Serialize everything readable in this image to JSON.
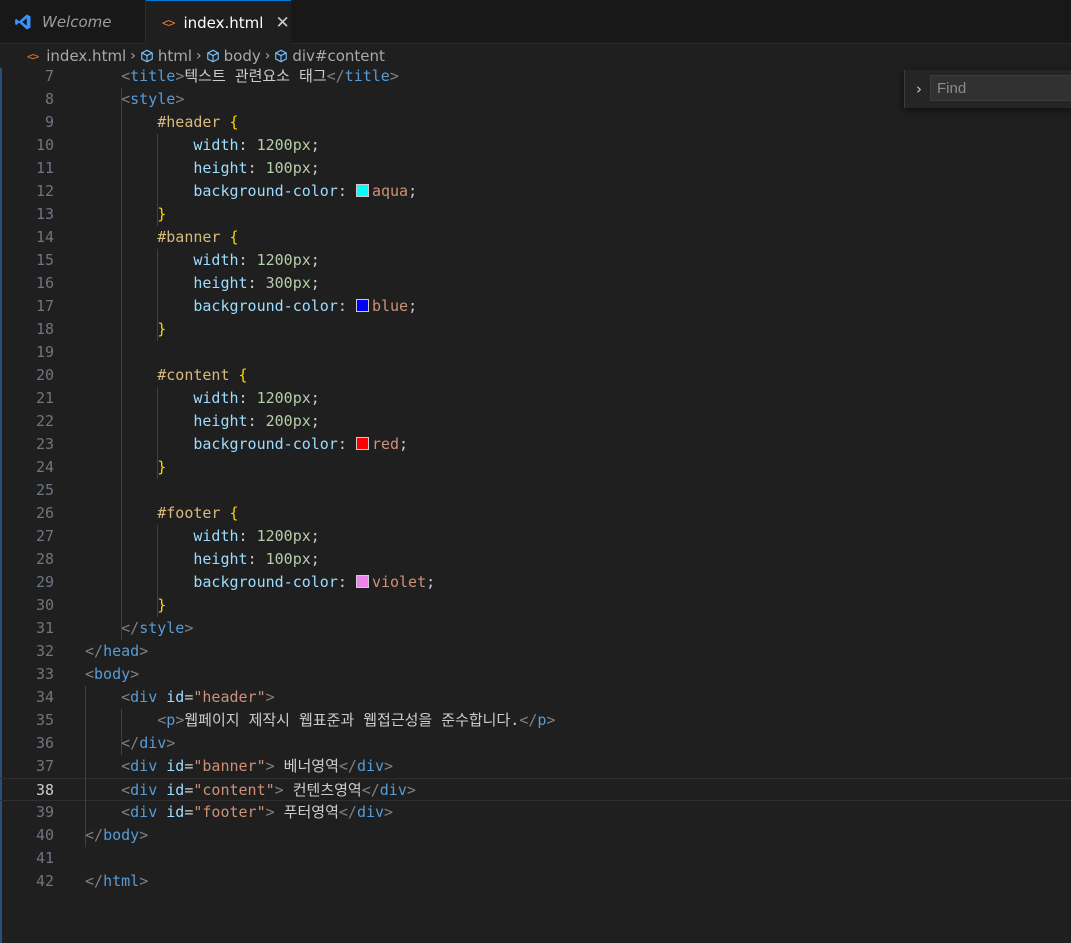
{
  "tabs": [
    {
      "label": "Welcome",
      "icon": "vscode-icon"
    },
    {
      "label": "index.html",
      "icon": "html-file-icon",
      "close_glyph": "✕"
    }
  ],
  "breadcrumb": [
    "index.html",
    "html",
    "body",
    "div#content"
  ],
  "find": {
    "placeholder": "Find",
    "toggle_glyph": "›"
  },
  "colors": {
    "aqua": "#00ffff",
    "blue": "#0000ff",
    "red": "#ff0000",
    "violet": "#ee82ee"
  },
  "current_line": 38,
  "lines": [
    {
      "n": "7",
      "t": "    <title>텍스트 관련요소 태그</title>"
    },
    {
      "n": "8",
      "t": "    <style>"
    },
    {
      "n": "9",
      "t": "        #header {"
    },
    {
      "n": "10",
      "t": "            width: 1200px;"
    },
    {
      "n": "11",
      "t": "            height: 100px;"
    },
    {
      "n": "12",
      "t": "            background-color: aqua;"
    },
    {
      "n": "13",
      "t": "        }"
    },
    {
      "n": "14",
      "t": "        #banner {"
    },
    {
      "n": "15",
      "t": "            width: 1200px;"
    },
    {
      "n": "16",
      "t": "            height: 300px;"
    },
    {
      "n": "17",
      "t": "            background-color: blue;"
    },
    {
      "n": "18",
      "t": "        }"
    },
    {
      "n": "19",
      "t": ""
    },
    {
      "n": "20",
      "t": "        #content {"
    },
    {
      "n": "21",
      "t": "            width: 1200px;"
    },
    {
      "n": "22",
      "t": "            height: 200px;"
    },
    {
      "n": "23",
      "t": "            background-color: red;"
    },
    {
      "n": "24",
      "t": "        }"
    },
    {
      "n": "25",
      "t": ""
    },
    {
      "n": "26",
      "t": "        #footer {"
    },
    {
      "n": "27",
      "t": "            width: 1200px;"
    },
    {
      "n": "28",
      "t": "            height: 100px;"
    },
    {
      "n": "29",
      "t": "            background-color: violet;"
    },
    {
      "n": "30",
      "t": "        }"
    },
    {
      "n": "31",
      "t": "    </style>"
    },
    {
      "n": "32",
      "t": "</head>"
    },
    {
      "n": "33",
      "t": "<body>"
    },
    {
      "n": "34",
      "t": "    <div id=\"header\">"
    },
    {
      "n": "35",
      "t": "        <p>웹페이지 제작시 웹표준과 웹접근성을 준수합니다.</p>"
    },
    {
      "n": "36",
      "t": "    </div>"
    },
    {
      "n": "37",
      "t": "    <div id=\"banner\"> 베너영역</div>"
    },
    {
      "n": "38",
      "t": "    <div id=\"content\"> 컨텐츠영역</div>"
    },
    {
      "n": "39",
      "t": "    <div id=\"footer\"> 푸터영역</div>"
    },
    {
      "n": "40",
      "t": "</body>"
    },
    {
      "n": "41",
      "t": ""
    },
    {
      "n": "42",
      "t": "</html>"
    }
  ]
}
